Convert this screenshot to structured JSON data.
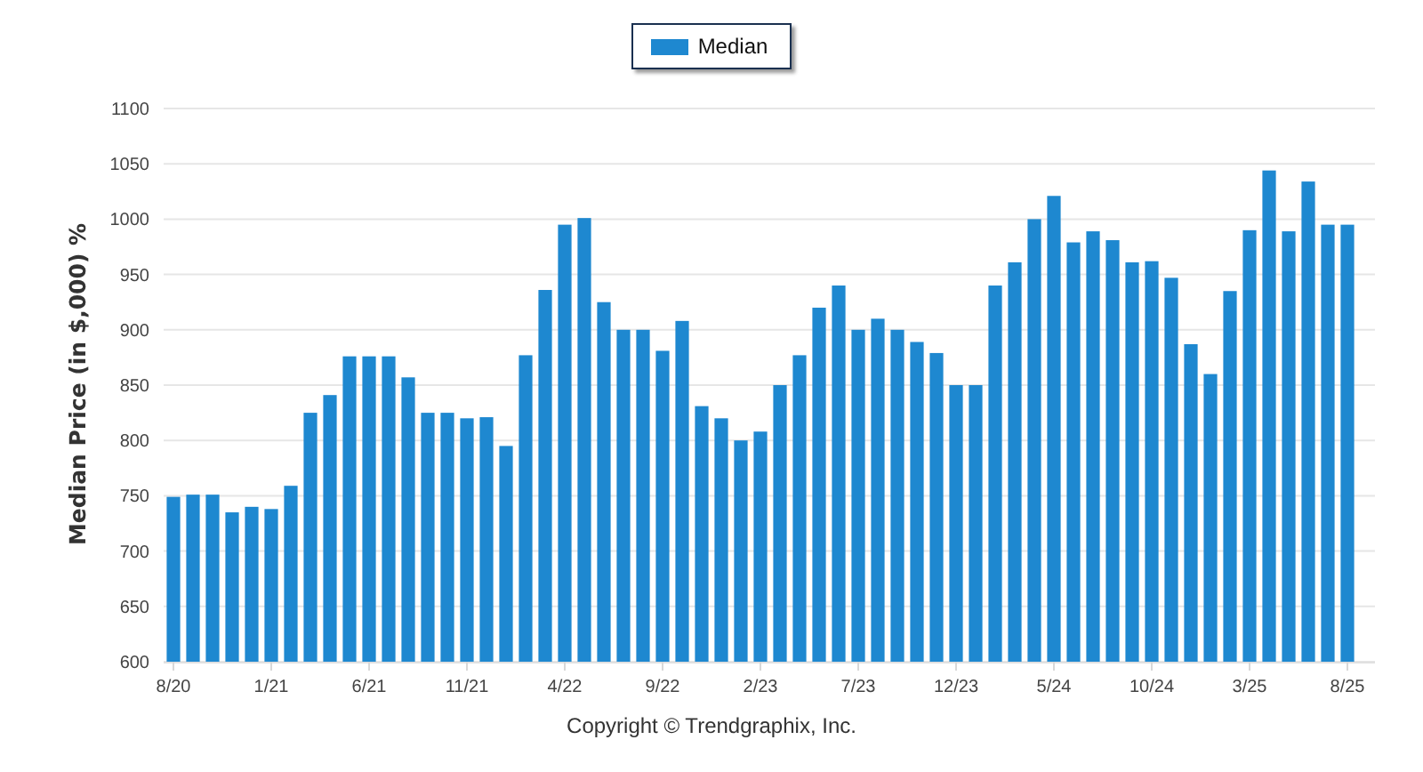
{
  "chart_data": {
    "type": "bar",
    "ylabel": "Median Price (in $,000) %",
    "ylim": [
      600,
      1100
    ],
    "yticks": [
      600,
      650,
      700,
      750,
      800,
      850,
      900,
      950,
      1000,
      1050,
      1100
    ],
    "grid": true,
    "categories": [
      "8/20",
      null,
      null,
      null,
      null,
      "1/21",
      null,
      null,
      null,
      null,
      "6/21",
      null,
      null,
      null,
      null,
      "11/21",
      null,
      null,
      null,
      null,
      "4/22",
      null,
      null,
      null,
      null,
      "9/22",
      null,
      null,
      null,
      null,
      "2/23",
      null,
      null,
      null,
      null,
      "7/23",
      null,
      null,
      null,
      null,
      "12/23",
      null,
      null,
      null,
      null,
      "5/24",
      null,
      null,
      null,
      null,
      "10/24",
      null,
      null,
      null,
      null,
      "3/25",
      null,
      null,
      null,
      null,
      "8/25"
    ],
    "series": [
      {
        "name": "Median",
        "color": "#1e88d0",
        "values": [
          749,
          751,
          751,
          735,
          740,
          738,
          759,
          825,
          841,
          876,
          876,
          876,
          857,
          825,
          825,
          820,
          821,
          795,
          877,
          936,
          995,
          1001,
          925,
          900,
          900,
          881,
          908,
          831,
          820,
          800,
          808,
          850,
          877,
          920,
          940,
          900,
          910,
          900,
          889,
          879,
          850,
          850,
          940,
          961,
          1000,
          1021,
          979,
          989,
          981,
          961,
          962,
          947,
          887,
          860,
          935,
          990,
          1044,
          989,
          1034,
          995,
          995
        ]
      }
    ]
  },
  "footer": "Copyright © Trendgraphix, Inc."
}
